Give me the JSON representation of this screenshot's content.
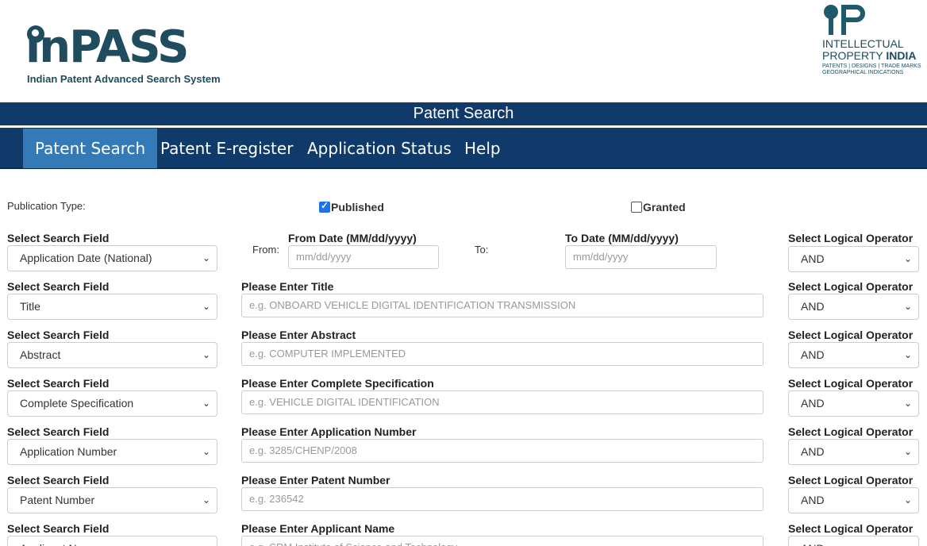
{
  "header": {
    "logo_text": "inPASS",
    "logo_subtitle": "Indian Patent Advanced Search System",
    "ipi_line1": "INTELLECTUAL",
    "ipi_line2a": "PROPERTY ",
    "ipi_line2b": "INDIA",
    "ipi_line3": "PATENTS | DESIGNS | TRADE MARKS",
    "ipi_line4": "GEOGRAPHICAL INDICATIONS"
  },
  "title_bar": "Patent Search",
  "nav": [
    "Patent Search",
    "Patent E-register",
    "Application Status",
    "Help"
  ],
  "publication": {
    "label": "Publication Type:",
    "published": "Published",
    "granted": "Granted"
  },
  "date_row": {
    "field_label": "Select Search Field",
    "field_value": "Application Date (National)",
    "from_word": "From:",
    "from_label": "From Date (MM/dd/yyyy)",
    "from_placeholder": "mm/dd/yyyy",
    "to_word": "To:",
    "to_label": "To Date (MM/dd/yyyy)",
    "to_placeholder": "mm/dd/yyyy",
    "op_label": "Select Logical Operator",
    "op_value": "AND"
  },
  "rows": [
    {
      "field_label": "Select Search Field",
      "field_value": "Title",
      "input_label": "Please Enter Title",
      "placeholder": "e.g. ONBOARD VEHICLE DIGITAL IDENTIFICATION TRANSMISSION",
      "op_label": "Select Logical Operator",
      "op_value": "AND"
    },
    {
      "field_label": "Select Search Field",
      "field_value": "Abstract",
      "input_label": "Please Enter Abstract",
      "placeholder": "e.g. COMPUTER IMPLEMENTED",
      "op_label": "Select Logical Operator",
      "op_value": "AND"
    },
    {
      "field_label": "Select Search Field",
      "field_value": "Complete Specification",
      "input_label": "Please Enter Complete Specification",
      "placeholder": "e.g.  VEHICLE DIGITAL IDENTIFICATION",
      "op_label": "Select Logical Operator",
      "op_value": "AND"
    },
    {
      "field_label": "Select Search Field",
      "field_value": "Application Number",
      "input_label": "Please Enter Application Number",
      "placeholder": "e.g. 3285/CHENP/2008",
      "op_label": "Select Logical Operator",
      "op_value": "AND"
    },
    {
      "field_label": "Select Search Field",
      "field_value": "Patent Number",
      "input_label": "Please Enter Patent Number",
      "placeholder": "e.g. 236542",
      "op_label": "Select Logical Operator",
      "op_value": "AND"
    },
    {
      "field_label": "Select Search Field",
      "field_value": "Applicant Name",
      "input_label": "Please Enter Applicant Name",
      "placeholder": "e.g. SRM Institute of Science and Technology",
      "op_label": "Select Logical Operator",
      "op_value": "AND"
    }
  ]
}
